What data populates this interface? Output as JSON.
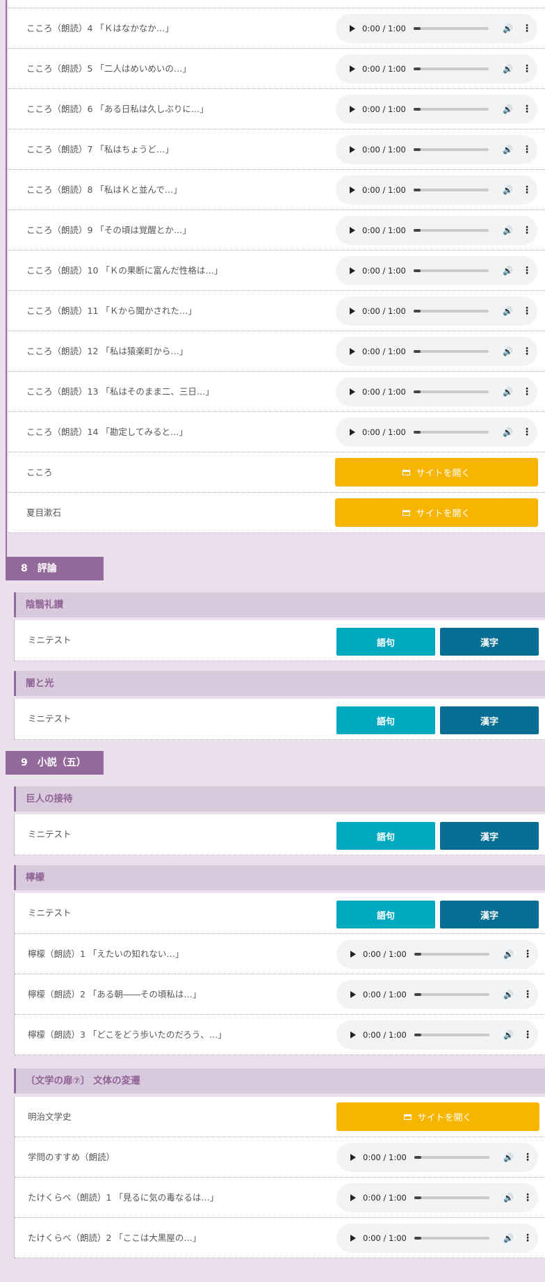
{
  "audio_controls": {
    "time": "0:00 / 1:00",
    "volume_icon": "🔊",
    "menu_icon": "⋮"
  },
  "buttons": {
    "site_open": "サイトを開く",
    "goku": "語句",
    "kanji": "漢字"
  },
  "top_rows": [
    "こころ（朗読）4 「Ｋはなかなか…」",
    "こころ（朗読）5 「二人はめいめいの…」",
    "こころ（朗読）6 「ある日私は久しぶりに…」",
    "こころ（朗読）7 「私はちょうど…」",
    "こころ（朗読）8 「私はＫと並んで…」",
    "こころ（朗読）9 「その頃は覚醒とか…」",
    "こころ（朗読）10 「Ｋの果断に富んだ性格は…」",
    "こころ（朗読）11 「Ｋから聞かされた…」",
    "こころ（朗読）12 「私は猿楽町から…」",
    "こころ（朗読）13 「私はそのまま二、三日…」",
    "こころ（朗読）14 「勘定してみると…」"
  ],
  "top_site_rows": [
    "こころ",
    "夏目漱石"
  ],
  "chapter8": {
    "title": "8　評論",
    "sections": [
      {
        "title": "陰翳礼讃",
        "row": "ミニテスト"
      },
      {
        "title": "闇と光",
        "row": "ミニテスト"
      }
    ]
  },
  "chapter9": {
    "title": "9　小説（五）",
    "section1": {
      "title": "巨人の接待",
      "row": "ミニテスト"
    },
    "section2": {
      "title": "檸檬",
      "test_row": "ミニテスト",
      "audio_rows": [
        "檸檬（朗読）1 「えたいの知れない…」",
        "檸檬（朗読）2 「ある朝――その頃私は…」",
        "檸檬（朗読）3 「どこをどう歩いたのだろう、…」"
      ]
    },
    "section3": {
      "title": "〔文学の扉⑦〕 文体の変遷",
      "site_row": "明治文学史",
      "audio_rows": [
        "学問のすすめ（朗読）",
        "たけくらべ（朗読）1 「見るに気の毒なるは…」",
        "たけくらべ（朗読）2 「ここは大黒屋の…」"
      ]
    }
  }
}
